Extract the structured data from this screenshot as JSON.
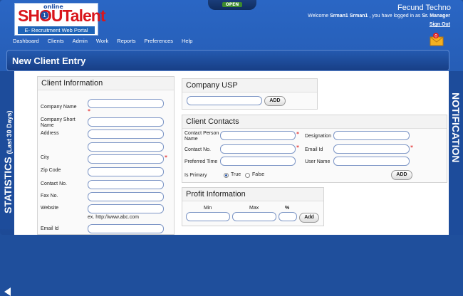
{
  "header": {
    "logo_online": "online",
    "logo_text": "SHOUTalent",
    "logo_badge": "1",
    "logo_sub": "E- Recruitment Web Portal",
    "open_label": "OPEN",
    "company_name": "Fecund Techno",
    "welcome_prefix": "Welcome",
    "user_name": "Srman1 Srman1",
    "welcome_mid": ", you have logged in as",
    "role": "Sr. Manager",
    "sign_out": "Sign Out",
    "mail_count": "0"
  },
  "nav": {
    "items": [
      "Dashboard",
      "Clients",
      "Admin",
      "Work",
      "Reports",
      "Preferences",
      "Help"
    ]
  },
  "page": {
    "title": "New Client Entry"
  },
  "rails": {
    "left_label": "STATISTICS",
    "left_sub": "(Last 30 Days)",
    "right_label": "NOTIFICATION"
  },
  "client_info": {
    "title": "Client Information",
    "fields": {
      "company_name": "Company Name",
      "company_short_name": "Company Short Name",
      "address": "Address",
      "city": "City",
      "zip_code": "Zip Code",
      "contact_no": "Contact No.",
      "fax_no": "Fax No.",
      "website": "Website",
      "website_hint": "ex. http://www.abc.com",
      "email_id": "Email Id"
    }
  },
  "company_usp": {
    "title": "Company USP",
    "add": "ADD"
  },
  "client_contacts": {
    "title": "Client Contacts",
    "contact_person_name": "Contact Person Name",
    "designation": "Designation",
    "contact_no": "Contact No.",
    "email_id": "Email Id",
    "preferred_time": "Preferred Time",
    "user_name": "User Name",
    "is_primary": "Is Primary",
    "true_label": "True",
    "false_label": "False",
    "add": "ADD"
  },
  "profit_info": {
    "title": "Profit Information",
    "min": "Min",
    "max": "Max",
    "pct": "%",
    "add": "Add"
  },
  "colors": {
    "brand_blue": "#1f4f9c",
    "logo_red": "#d9151b",
    "required": "#dd0000"
  }
}
